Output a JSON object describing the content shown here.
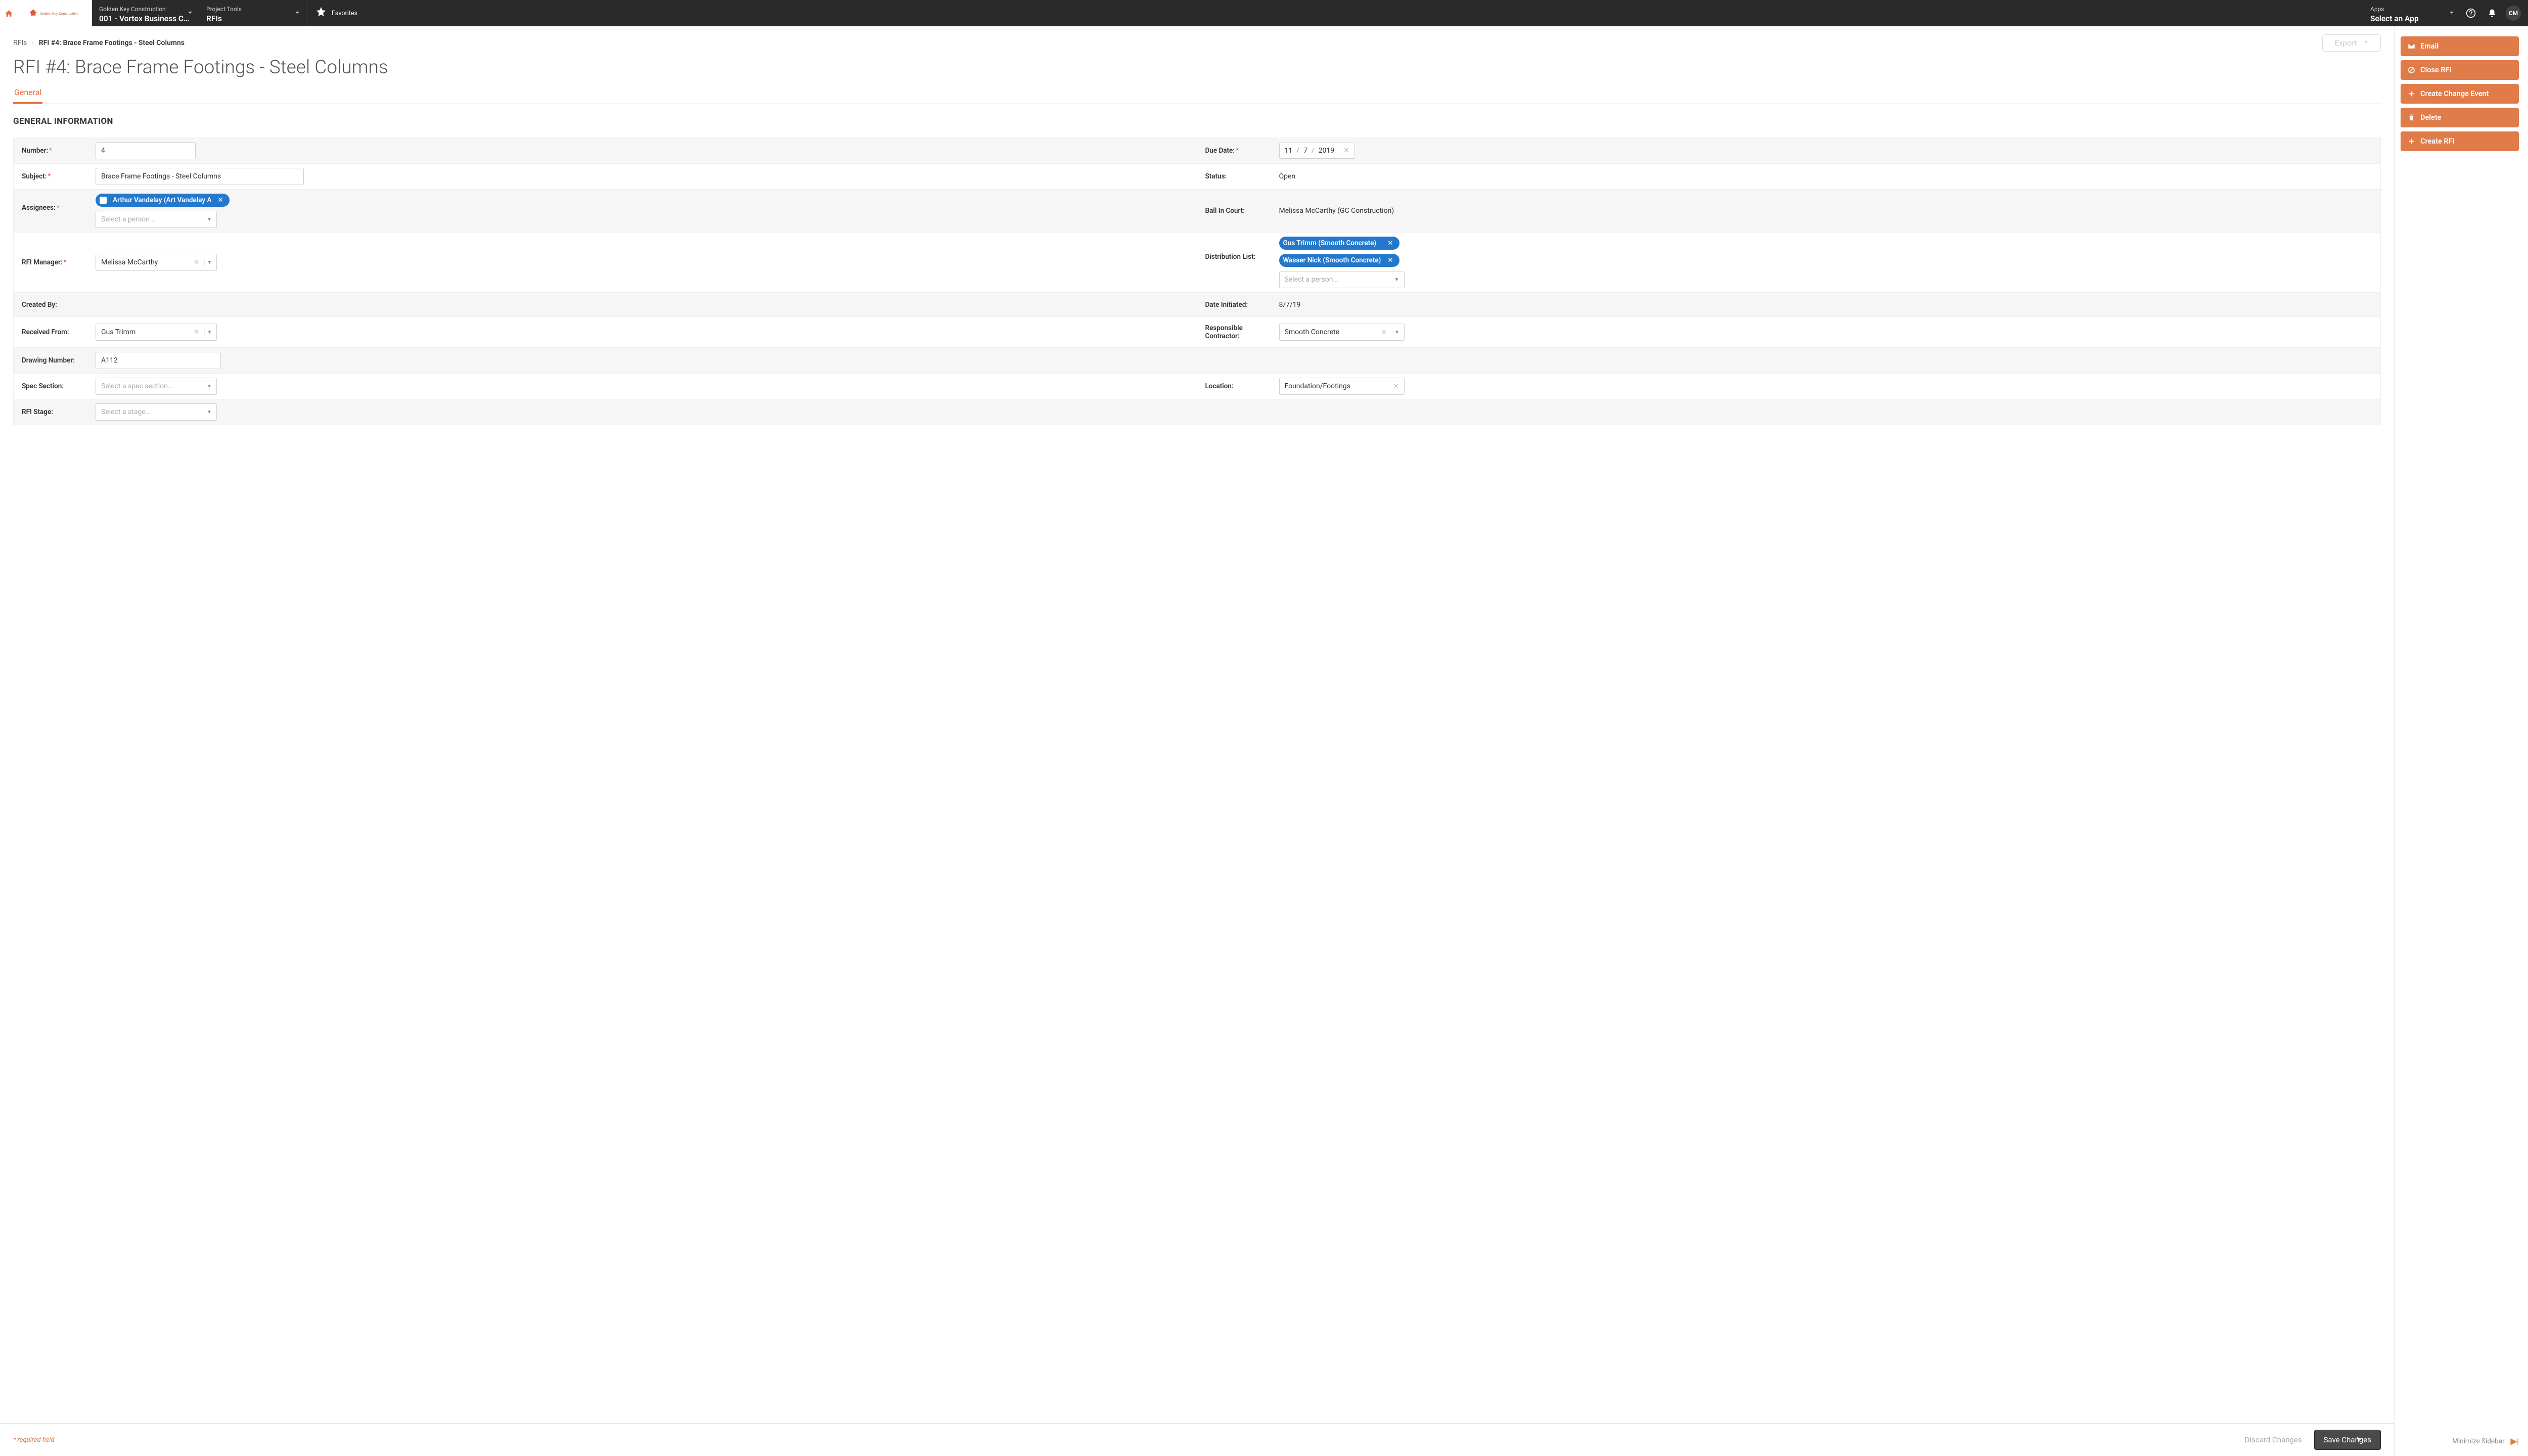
{
  "topbar": {
    "company_dropdown": {
      "label": "Golden Key Construction",
      "value": "001 - Vortex Business Ce..."
    },
    "tool_dropdown": {
      "label": "Project Tools",
      "value": "RFIs"
    },
    "favorites_label": "Favorites",
    "apps_dropdown": {
      "label": "Apps",
      "value": "Select an App"
    },
    "avatar_initials": "CM",
    "logo_text_top": "Golden Key Construction"
  },
  "breadcrumb": {
    "root": "RFIs",
    "current": "RFI #4: Brace Frame Footings - Steel Columns"
  },
  "export_label": "Export",
  "page_title": "RFI #4: Brace Frame Footings - Steel Columns",
  "tabs": {
    "general": "General"
  },
  "section_heading": "GENERAL INFORMATION",
  "labels": {
    "number": "Number:",
    "due_date": "Due Date:",
    "subject": "Subject:",
    "status": "Status:",
    "assignees": "Assignees:",
    "ball_in_court": "Ball In Court:",
    "rfi_manager": "RFI Manager:",
    "distribution_list": "Distribution List:",
    "created_by": "Created By:",
    "date_initiated": "Date Initiated:",
    "received_from": "Received From:",
    "responsible_contractor": "Responsible Contractor:",
    "drawing_number": "Drawing Number:",
    "spec_section": "Spec Section:",
    "location": "Location:",
    "rfi_stage": "RFI Stage:"
  },
  "fields": {
    "number": "4",
    "due_date": {
      "m": "11",
      "d": "7",
      "y": "2019"
    },
    "subject": "Brace Frame Footings - Steel Columns",
    "status": "Open",
    "assignee_chip": "Arthur Vandelay (Art Vandelay A",
    "assignee_placeholder": "Select a person...",
    "ball_in_court": "Melissa McCarthy (GC Construction)",
    "rfi_manager": "Melissa McCarthy",
    "distribution_chips": [
      "Gus Trimm (Smooth Concrete)",
      "Wasser Nick (Smooth Concrete)"
    ],
    "distribution_placeholder": "Select a person...",
    "created_by": "",
    "date_initiated": "8/7/19",
    "received_from": "Gus Trimm",
    "responsible_contractor": "Smooth Concrete",
    "drawing_number": "A112",
    "spec_section_placeholder": "Select a spec section...",
    "location": "Foundation/Footings",
    "rfi_stage_placeholder": "Select a stage..."
  },
  "sidebar": {
    "email": "Email",
    "close_rfi": "Close RFI",
    "create_change_event": "Create Change Event",
    "delete": "Delete",
    "create_rfi": "Create RFI",
    "minimize": "Minimize Sidebar"
  },
  "footer": {
    "required_note": "* required field",
    "discard": "Discard Changes",
    "save": "Save Changes"
  },
  "colors": {
    "accent": "#e07b4a",
    "chip": "#2478cc"
  }
}
